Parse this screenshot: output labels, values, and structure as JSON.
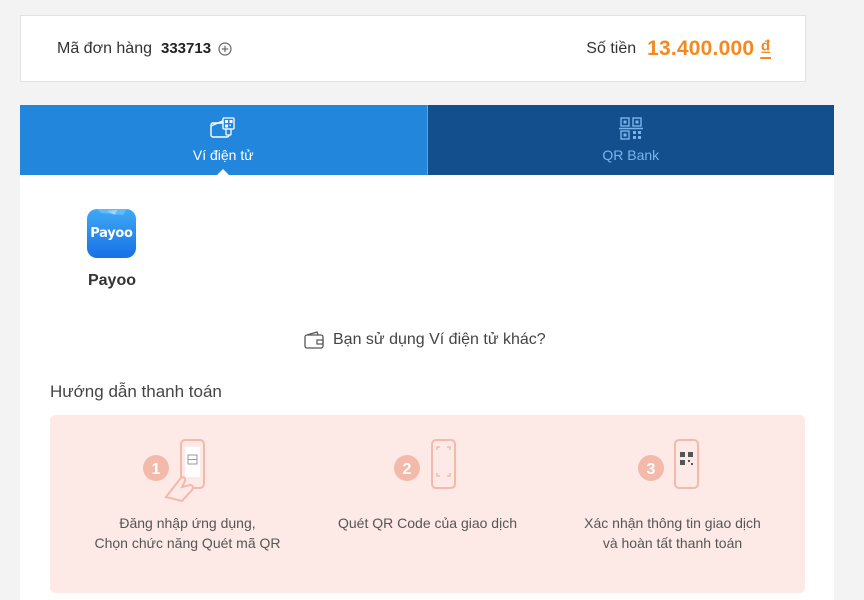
{
  "order": {
    "label": "Mã đơn hàng",
    "id": "333713",
    "amount_label": "Số tiền",
    "amount_value": "13.400.000",
    "currency": "₫"
  },
  "tabs": [
    {
      "label": "Ví điện tử",
      "icon": "wallet-qr-icon",
      "active": true
    },
    {
      "label": "QR Bank",
      "icon": "qr-icon",
      "active": false
    }
  ],
  "wallets": [
    {
      "name": "Payoo",
      "logo_text": "Payoo"
    }
  ],
  "other_wallet_text": "Bạn sử dụng Ví điện tử khác?",
  "guide": {
    "title": "Hướng dẫn thanh toán",
    "steps": [
      {
        "number": "1",
        "line1": "Đăng nhập ứng dụng,",
        "line2": "Chọn chức năng Quét mã QR"
      },
      {
        "number": "2",
        "line1": "Quét QR Code của giao dịch",
        "line2": ""
      },
      {
        "number": "3",
        "line1": "Xác nhận thông tin giao dịch",
        "line2": "và hoàn tất thanh toán"
      }
    ]
  },
  "colors": {
    "accent_orange": "#f5891f",
    "tab_active": "#2386dd",
    "tab_inactive": "#134f8d",
    "guide_bg": "#fdeae6"
  }
}
